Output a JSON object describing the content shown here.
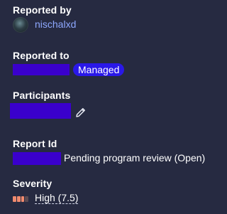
{
  "reported_by": {
    "heading": "Reported by",
    "username": "nischalxd"
  },
  "reported_to": {
    "heading": "Reported to",
    "badge": "Managed"
  },
  "participants": {
    "heading": "Participants",
    "edit_icon": "pencil-icon"
  },
  "report_id": {
    "heading": "Report Id",
    "status": "Pending program review (Open)"
  },
  "severity": {
    "heading": "Severity",
    "value": "High (7.5)",
    "level_fraction": 0.75,
    "colors": {
      "filled": "#f08a6e",
      "empty": "#5a4a52"
    }
  },
  "colors": {
    "background": "#262a41",
    "link": "#8ea8ff",
    "badge": "#2a18e8",
    "redaction": "#3a00cc"
  }
}
